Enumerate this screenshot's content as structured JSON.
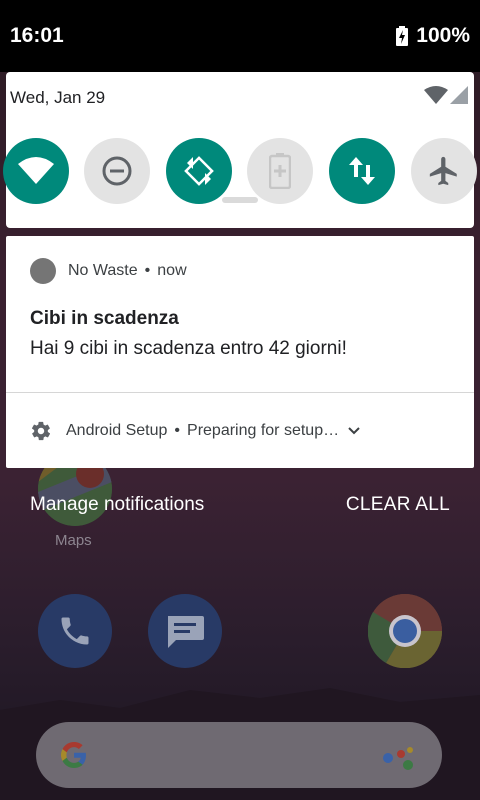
{
  "status_bar": {
    "time": "16:01",
    "battery": "100%"
  },
  "quick_settings": {
    "date": "Wed, Jan 29",
    "tiles": [
      {
        "name": "wifi",
        "state": "on"
      },
      {
        "name": "do-not-disturb",
        "state": "off"
      },
      {
        "name": "auto-rotate",
        "state": "on"
      },
      {
        "name": "battery-saver",
        "state": "disabled"
      },
      {
        "name": "mobile-data",
        "state": "on"
      },
      {
        "name": "airplane-mode",
        "state": "off"
      }
    ]
  },
  "notification": {
    "app_name": "No Waste",
    "separator": "•",
    "time": "now",
    "title": "Cibi in scadenza",
    "text": "Hai 9 cibi in scadenza entro 42 giorni!"
  },
  "setup_notification": {
    "app_name": "Android Setup",
    "separator": "•",
    "text": "Preparing for setup…"
  },
  "actions": {
    "manage": "Manage notifications",
    "clear_all": "CLEAR ALL"
  },
  "home": {
    "maps_label": "Maps"
  },
  "colors": {
    "accent": "#00897b",
    "tile_off": "#e3e3e3"
  }
}
